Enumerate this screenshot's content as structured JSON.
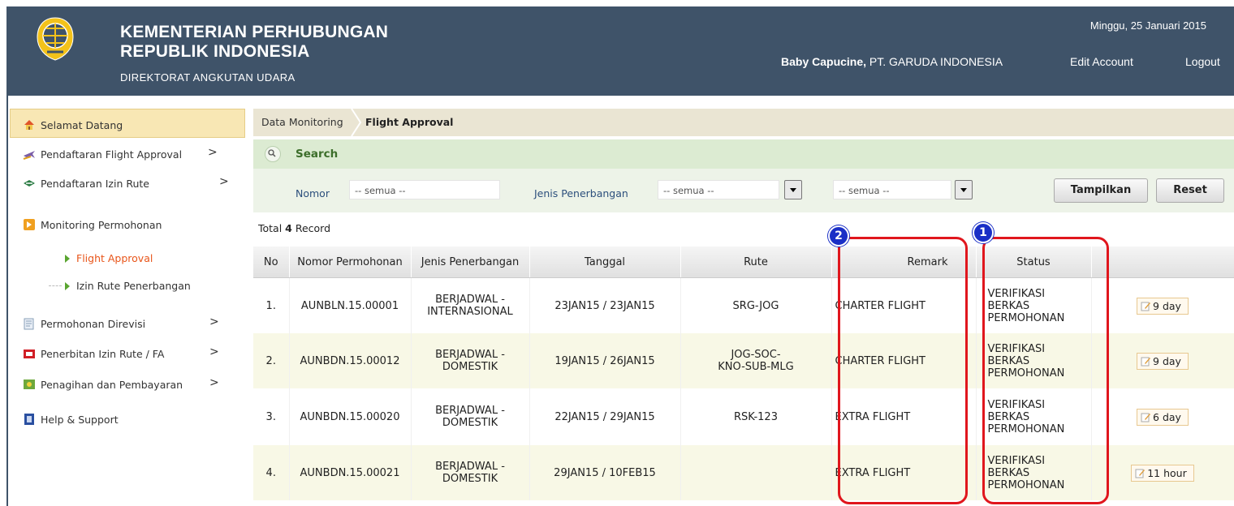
{
  "header": {
    "org_line1": "KEMENTERIAN PERHUBUNGAN",
    "org_line2": "REPUBLIK INDONESIA",
    "org_line3": "DIREKTORAT ANGKUTAN UDARA",
    "date": "Minggu, 25 Januari 2015",
    "user_name": "Baby Capucine,",
    "user_company": " PT. GARUDA INDONESIA",
    "edit_account": "Edit Account",
    "logout": "Logout"
  },
  "sidebar": {
    "items": [
      {
        "label": "Selamat Datang"
      },
      {
        "label": "Pendaftaran Flight Approval"
      },
      {
        "label": "Pendaftaran Izin Rute"
      },
      {
        "label": "Monitoring Permohonan"
      },
      {
        "label": "Permohonan Direvisi"
      },
      {
        "label": "Penerbitan Izin Rute / FA"
      },
      {
        "label": "Penagihan dan Pembayaran"
      },
      {
        "label": "Help & Support"
      }
    ],
    "sub_items": [
      {
        "label": "Flight Approval"
      },
      {
        "label": "Izin Rute Penerbangan"
      }
    ],
    "chevron": ">"
  },
  "breadcrumb": {
    "parent": "Data Monitoring",
    "current": "Flight Approval"
  },
  "search": {
    "title": "Search",
    "nomor_label": "Nomor",
    "nomor_value": "-- semua --",
    "jenis_label": "Jenis Penerbangan",
    "jenis_value": "-- semua --",
    "third_value": "-- semua --",
    "show_button": "Tampilkan",
    "reset_button": "Reset"
  },
  "total": {
    "prefix": "Total ",
    "count": "4",
    "suffix": " Record"
  },
  "table": {
    "columns": [
      "No",
      "Nomor Permohonan",
      "Jenis Penerbangan",
      "Tanggal",
      "Rute",
      "Remark",
      "Status",
      ""
    ],
    "rows": [
      {
        "no": "1.",
        "nomor": "AUNBLN.15.00001",
        "jenis1": "BERJADWAL -",
        "jenis2": "INTERNASIONAL",
        "tanggal": "23JAN15 / 23JAN15",
        "rute1": "SRG-JOG",
        "rute2": "",
        "remark": "CHARTER FLIGHT",
        "status1": "VERIFIKASI",
        "status2": "BERKAS",
        "status3": "PERMOHONAN",
        "time": "9 day"
      },
      {
        "no": "2.",
        "nomor": "AUNBDN.15.00012",
        "jenis1": "BERJADWAL -",
        "jenis2": "DOMESTIK",
        "tanggal": "19JAN15 / 26JAN15",
        "rute1": "JOG-SOC-",
        "rute2": "KNO-SUB-MLG",
        "remark": "CHARTER FLIGHT",
        "status1": "VERIFIKASI",
        "status2": "BERKAS",
        "status3": "PERMOHONAN",
        "time": "9 day"
      },
      {
        "no": "3.",
        "nomor": "AUNBDN.15.00020",
        "jenis1": "BERJADWAL -",
        "jenis2": "DOMESTIK",
        "tanggal": "22JAN15 / 29JAN15",
        "rute1": "RSK-123",
        "rute2": "",
        "remark": "EXTRA FLIGHT",
        "status1": "VERIFIKASI",
        "status2": "BERKAS",
        "status3": "PERMOHONAN",
        "time": "6 day"
      },
      {
        "no": "4.",
        "nomor": "AUNBDN.15.00021",
        "jenis1": "BERJADWAL -",
        "jenis2": "DOMESTIK",
        "tanggal": "29JAN15 / 10FEB15",
        "rute1": "",
        "rute2": "",
        "remark": "EXTRA FLIGHT",
        "status1": "VERIFIKASI",
        "status2": "BERKAS",
        "status3": "PERMOHONAN",
        "time": "11 hour"
      }
    ]
  },
  "annotations": {
    "marker1": "1",
    "marker2": "2"
  },
  "colors": {
    "header_bg": "#3f5369",
    "selected_bg": "#f8e7b4",
    "annotation_red": "#e0161d",
    "marker_blue": "#1a2fc6",
    "active_sub": "#e8551a"
  }
}
